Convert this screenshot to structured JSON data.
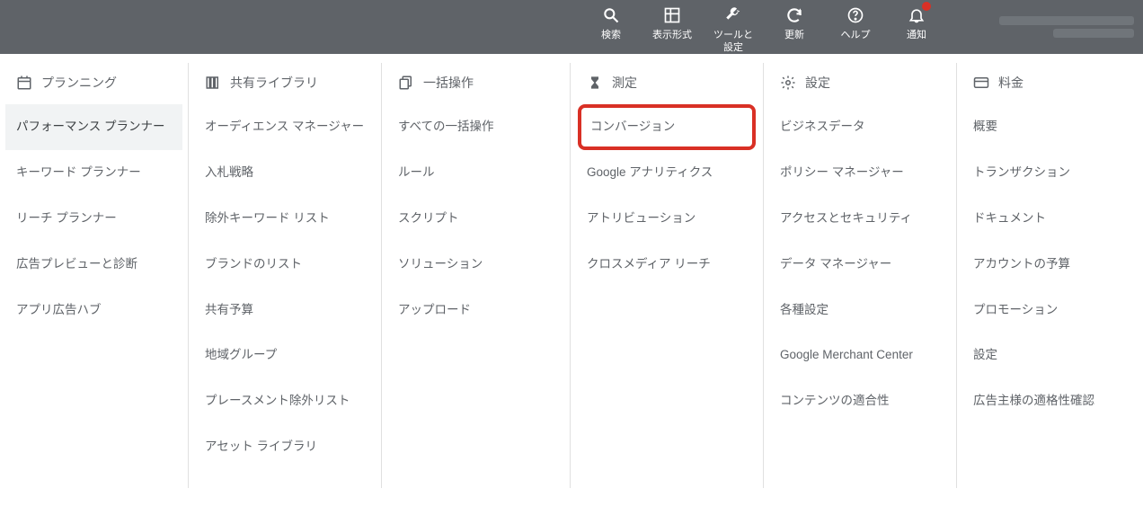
{
  "topbar": {
    "items": [
      {
        "label": "検索"
      },
      {
        "label": "表示形式"
      },
      {
        "label": "ツールと\n設定"
      },
      {
        "label": "更新"
      },
      {
        "label": "ヘルプ"
      },
      {
        "label": "通知"
      }
    ]
  },
  "columns": [
    {
      "header": "プランニング",
      "items": [
        "パフォーマンス プランナー",
        "キーワード プランナー",
        "リーチ プランナー",
        "広告プレビューと診断",
        "アプリ広告ハブ"
      ]
    },
    {
      "header": "共有ライブラリ",
      "items": [
        "オーディエンス マネージャー",
        "入札戦略",
        "除外キーワード リスト",
        "ブランドのリスト",
        "共有予算",
        "地域グループ",
        "プレースメント除外リスト",
        "アセット ライブラリ"
      ]
    },
    {
      "header": "一括操作",
      "items": [
        "すべての一括操作",
        "ルール",
        "スクリプト",
        "ソリューション",
        "アップロード"
      ]
    },
    {
      "header": "測定",
      "items": [
        "コンバージョン",
        "Google アナリティクス",
        "アトリビューション",
        "クロスメディア リーチ"
      ]
    },
    {
      "header": "設定",
      "items": [
        "ビジネスデータ",
        "ポリシー マネージャー",
        "アクセスとセキュリティ",
        "データ マネージャー",
        "各種設定",
        "Google Merchant Center",
        "コンテンツの適合性"
      ]
    },
    {
      "header": "料金",
      "items": [
        "概要",
        "トランザクション",
        "ドキュメント",
        "アカウントの予算",
        "プロモーション",
        "設定",
        "広告主様の適格性確認"
      ]
    }
  ]
}
